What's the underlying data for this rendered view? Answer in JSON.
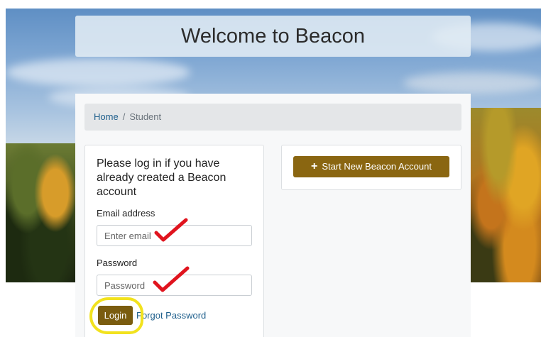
{
  "page": {
    "title": "Welcome to Beacon"
  },
  "breadcrumb": {
    "home": "Home",
    "separator": "/",
    "current": "Student"
  },
  "login": {
    "intro": "Please log in if you have already created a Beacon account",
    "email_label": "Email address",
    "email_placeholder": "Enter email",
    "email_value": "",
    "password_label": "Password",
    "password_placeholder": "Password",
    "password_value": "",
    "login_label": "Login",
    "forgot_label": "Forgot Password"
  },
  "signup": {
    "start_label": "Start New Beacon Account",
    "icon": "plus-icon"
  },
  "annotations": {
    "checkmark_color": "#e0141e",
    "highlight_color": "#f2e21e"
  },
  "colors": {
    "brand": "#8a6611",
    "link": "#1e5f8c"
  }
}
